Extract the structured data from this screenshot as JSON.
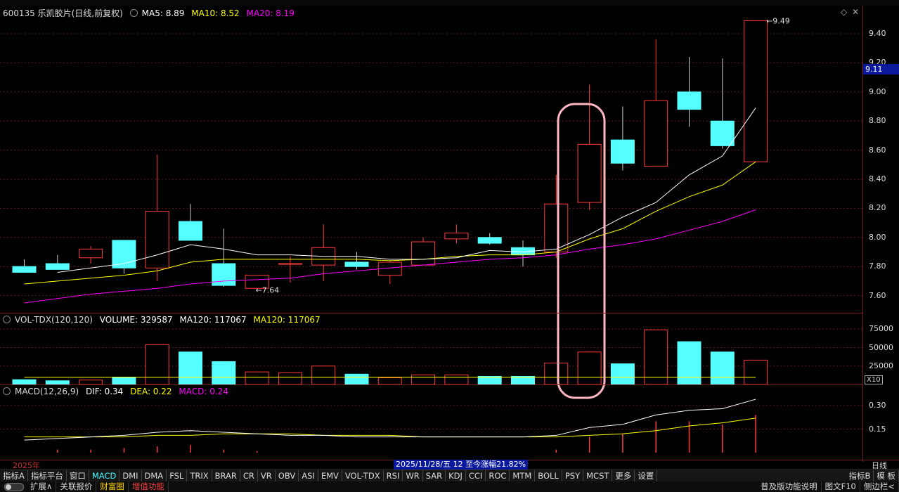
{
  "header": {
    "stock": "600135 乐凯胶片(日线,前复权)",
    "ma5": "MA5: 8.89",
    "ma10": "MA10: 8.52",
    "ma20": "MA20: 8.19",
    "vol_name": "VOL-TDX(120,120)",
    "volume": "VOLUME: 329587",
    "vma1": "MA120: 117067",
    "vma2": "MA120: 117067",
    "macd_name": "MACD(12,26,9)",
    "dif": "DIF: 0.34",
    "dea": "DEA: 0.22",
    "macd": "MACD: 0.24"
  },
  "axis": {
    "current_price": "9.11",
    "price_ticks": [
      "9.40",
      "9.20",
      "9.00",
      "8.80",
      "8.60",
      "8.40",
      "8.20",
      "8.00",
      "7.80",
      "7.60"
    ],
    "vol_ticks": [
      "75000",
      "50000",
      "25000"
    ],
    "vol_unit": "X10",
    "macd_ticks": [
      "0.30",
      "0.15"
    ],
    "high_label": "9.49",
    "low_label": "7.64"
  },
  "status": {
    "year": "2025年",
    "range_text": "2025/11/28/五 12 至今涨幅21.82%",
    "period": "日线"
  },
  "tabs": [
    "指标A",
    "指标平台",
    "窗口",
    "MACD",
    "DMI",
    "DMA",
    "FSL",
    "TRIX",
    "BRAR",
    "CR",
    "VR",
    "OBV",
    "ASI",
    "EMV",
    "VOL-TDX",
    "RSI",
    "WR",
    "SAR",
    "KDJ",
    "CCI",
    "ROC",
    "MTM",
    "BOLL",
    "PSY",
    "MCST",
    "更多",
    "设置"
  ],
  "tabs_right": [
    "指标B",
    "模 板"
  ],
  "bottom": {
    "items": [
      "扩展∧",
      "关联报价",
      "财富圈",
      "增值功能"
    ],
    "right": [
      "普及版功能说明",
      "图文F10",
      "侧边栏<"
    ]
  },
  "colors": {
    "up": "#ff3b3b",
    "down": "#54ffff",
    "ma5": "#ffffff",
    "ma10": "#ffff00",
    "ma20": "#ff00ff",
    "grid": "#5a1a1a",
    "highlight": "#ffb6c1"
  },
  "chart_data": [
    {
      "type": "candlestick",
      "title": "600135 乐凯胶片(日线,前复权)",
      "ylim": [
        7.5,
        9.55
      ],
      "candles": [
        {
          "o": 7.8,
          "h": 7.85,
          "l": 7.76,
          "c": 7.76
        },
        {
          "o": 7.82,
          "h": 7.88,
          "l": 7.79,
          "c": 7.78
        },
        {
          "o": 7.86,
          "h": 7.94,
          "l": 7.82,
          "c": 7.92
        },
        {
          "o": 7.98,
          "h": 7.98,
          "l": 7.75,
          "c": 7.79
        },
        {
          "o": 7.79,
          "h": 8.57,
          "l": 7.7,
          "c": 8.18
        },
        {
          "o": 8.11,
          "h": 8.23,
          "l": 7.98,
          "c": 7.98
        },
        {
          "o": 7.82,
          "h": 8.06,
          "l": 7.66,
          "c": 7.67
        },
        {
          "o": 7.65,
          "h": 7.74,
          "l": 7.64,
          "c": 7.74
        },
        {
          "o": 7.82,
          "h": 7.87,
          "l": 7.69,
          "c": 7.82
        },
        {
          "o": 7.81,
          "h": 8.09,
          "l": 7.7,
          "c": 7.93
        },
        {
          "o": 7.83,
          "h": 7.9,
          "l": 7.78,
          "c": 7.8
        },
        {
          "o": 7.74,
          "h": 7.84,
          "l": 7.68,
          "c": 7.83
        },
        {
          "o": 7.81,
          "h": 8.0,
          "l": 7.81,
          "c": 7.97
        },
        {
          "o": 7.99,
          "h": 8.09,
          "l": 7.96,
          "c": 8.03
        },
        {
          "o": 8.0,
          "h": 8.03,
          "l": 7.95,
          "c": 7.96
        },
        {
          "o": 7.93,
          "h": 7.98,
          "l": 7.8,
          "c": 7.88
        },
        {
          "o": 7.9,
          "h": 8.43,
          "l": 7.86,
          "c": 8.23
        },
        {
          "o": 8.24,
          "h": 9.05,
          "l": 8.19,
          "c": 8.64
        },
        {
          "o": 8.67,
          "h": 8.9,
          "l": 8.46,
          "c": 8.51
        },
        {
          "o": 8.49,
          "h": 9.36,
          "l": 8.49,
          "c": 8.94
        },
        {
          "o": 9.0,
          "h": 9.24,
          "l": 8.76,
          "c": 8.88
        },
        {
          "o": 8.8,
          "h": 9.23,
          "l": 8.61,
          "c": 8.63
        },
        {
          "o": 8.52,
          "h": 9.49,
          "l": 8.52,
          "c": 9.49
        }
      ],
      "ma5": [
        null,
        7.76,
        7.79,
        7.82,
        7.88,
        7.95,
        7.92,
        7.88,
        7.88,
        7.87,
        7.87,
        7.85,
        7.85,
        7.86,
        7.91,
        7.9,
        7.92,
        8.02,
        8.14,
        8.24,
        8.43,
        8.56,
        8.89
      ],
      "ma10": [
        7.68,
        7.7,
        7.72,
        7.74,
        7.77,
        7.83,
        7.85,
        7.85,
        7.85,
        7.85,
        7.85,
        7.84,
        7.85,
        7.87,
        7.88,
        7.88,
        7.9,
        7.99,
        8.06,
        8.18,
        8.28,
        8.36,
        8.52
      ],
      "ma20": [
        7.55,
        7.58,
        7.61,
        7.63,
        7.65,
        7.68,
        7.7,
        7.71,
        7.72,
        7.75,
        7.77,
        7.79,
        7.81,
        7.83,
        7.85,
        7.86,
        7.88,
        7.92,
        7.95,
        7.99,
        8.05,
        8.11,
        8.19
      ]
    },
    {
      "type": "bar",
      "title": "VOL-TDX(120,120)",
      "ylim": [
        0,
        80000
      ],
      "values": [
        6500,
        5000,
        6000,
        10000,
        54000,
        44000,
        31000,
        17000,
        16000,
        25000,
        14000,
        9000,
        13000,
        13000,
        11000,
        11000,
        29000,
        44000,
        28000,
        74000,
        58000,
        44000,
        33000
      ],
      "up": [
        false,
        false,
        true,
        false,
        true,
        false,
        false,
        true,
        true,
        true,
        false,
        true,
        true,
        true,
        false,
        false,
        true,
        true,
        false,
        true,
        false,
        false,
        true
      ],
      "ma120": 9800
    },
    {
      "type": "line",
      "title": "MACD(12,26,9)",
      "ylim": [
        0,
        0.36
      ],
      "dif": [
        0.08,
        0.09,
        0.1,
        0.11,
        0.13,
        0.14,
        0.13,
        0.12,
        0.11,
        0.11,
        0.1,
        0.1,
        0.1,
        0.1,
        0.1,
        0.1,
        0.11,
        0.16,
        0.18,
        0.24,
        0.27,
        0.28,
        0.34
      ],
      "dea": [
        0.1,
        0.1,
        0.1,
        0.1,
        0.11,
        0.11,
        0.12,
        0.12,
        0.12,
        0.11,
        0.11,
        0.11,
        0.1,
        0.1,
        0.1,
        0.1,
        0.1,
        0.11,
        0.12,
        0.14,
        0.17,
        0.19,
        0.22
      ],
      "macd": [
        0.0,
        0.02,
        0.02,
        0.03,
        0.04,
        0.05,
        0.02,
        0.01,
        0.0,
        0.0,
        0.0,
        0.0,
        0.0,
        0.0,
        0.0,
        0.0,
        0.02,
        0.1,
        0.12,
        0.2,
        0.2,
        0.18,
        0.24
      ]
    }
  ]
}
